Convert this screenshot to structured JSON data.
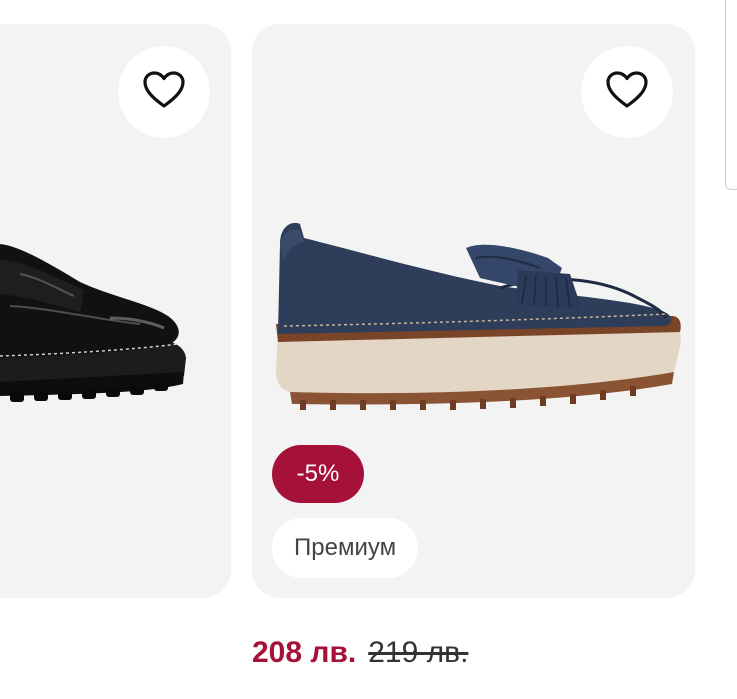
{
  "products": [
    {
      "name": "black-patent-loafer",
      "favorite_icon": "heart-outline-icon"
    },
    {
      "name": "navy-platform-loafer",
      "favorite_icon": "heart-outline-icon",
      "discount_badge": "-5%",
      "tag_badge": "Премиум",
      "price_current": "208 лв.",
      "price_old": "219 лв."
    }
  ],
  "colors": {
    "accent": "#a6113a",
    "card_bg": "#f3f3f3"
  }
}
